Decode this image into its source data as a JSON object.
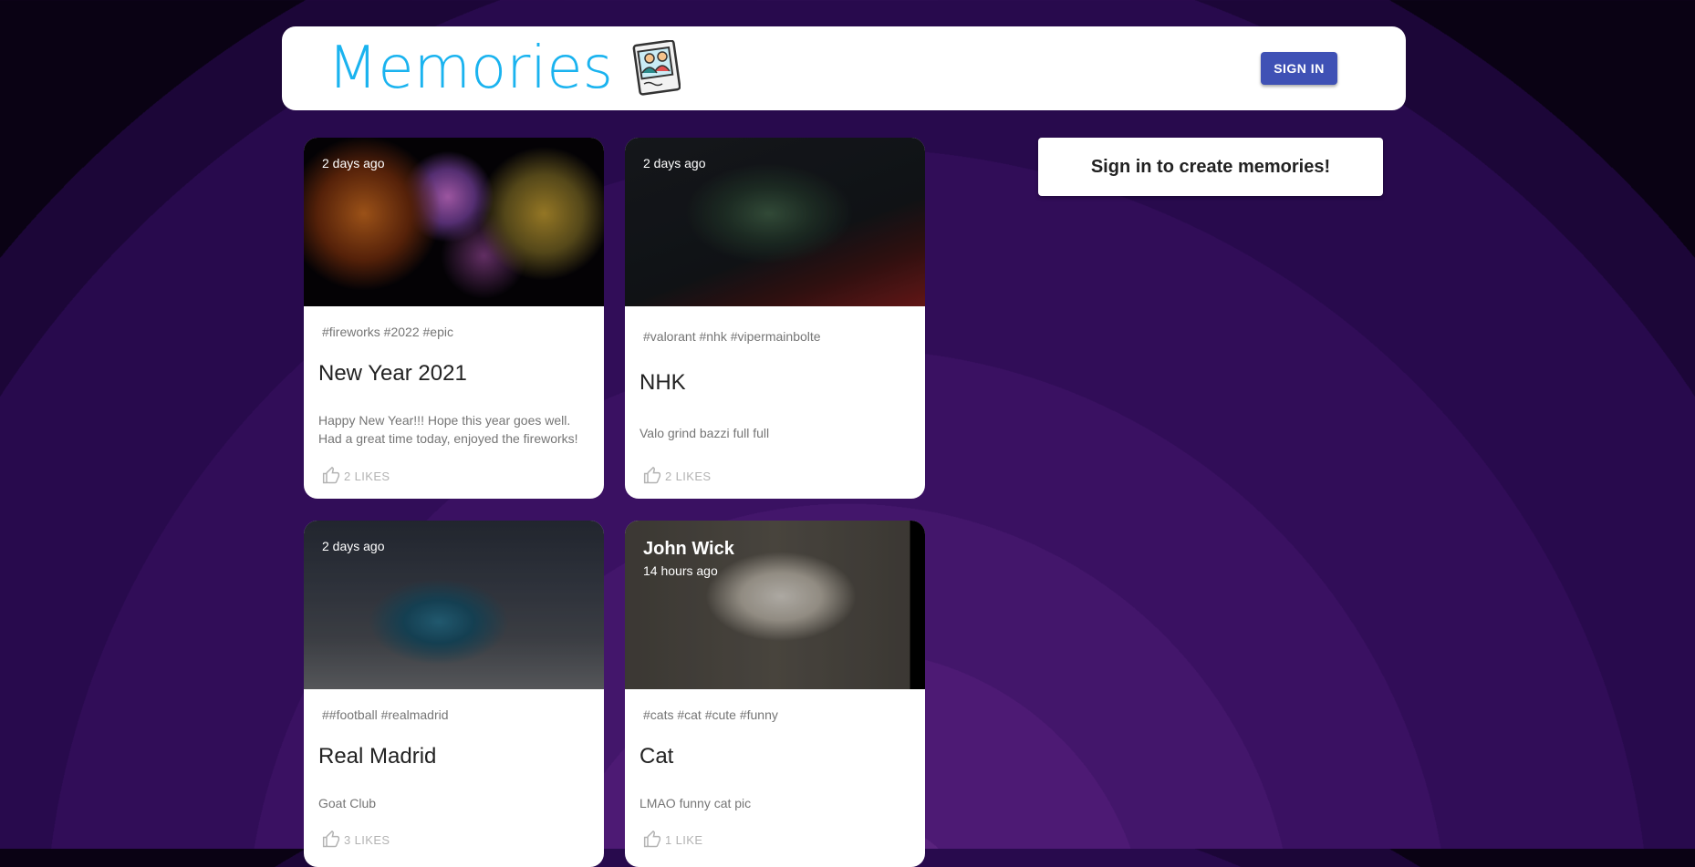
{
  "header": {
    "brand_title": "Memories",
    "sign_in_label": "SIGN IN",
    "brand_icon": "photo-memories-icon"
  },
  "sidebar": {
    "signin_prompt": "Sign in to create memories!"
  },
  "posts": [
    {
      "author": "",
      "time": "2 days ago",
      "tags": "#fireworks #2022 #epic",
      "title": "New Year 2021",
      "message": "Happy New Year!!! Hope this year goes well. Had a great time today, enjoyed the fireworks!",
      "likes": "2 LIKES",
      "image": "fireworks-image"
    },
    {
      "author": "",
      "time": "2 days ago",
      "tags": "#valorant #nhk #vipermainbolte",
      "title": "NHK",
      "message": "Valo grind bazzi full full",
      "likes": "2 LIKES",
      "image": "valorant-image"
    },
    {
      "author": "",
      "time": "2 days ago",
      "tags": "##football #realmadrid",
      "title": "Real Madrid",
      "message": "Goat Club",
      "likes": "3 LIKES",
      "image": "football-image"
    },
    {
      "author": "John Wick",
      "time": "14 hours ago",
      "tags": "#cats #cat #cute #funny",
      "title": "Cat",
      "message": "LMAO funny cat pic",
      "likes": "1 LIKE",
      "image": "cat-image"
    }
  ],
  "colors": {
    "brand": "#1ab3ef",
    "button": "#3f51b5",
    "background": "#310d58"
  }
}
